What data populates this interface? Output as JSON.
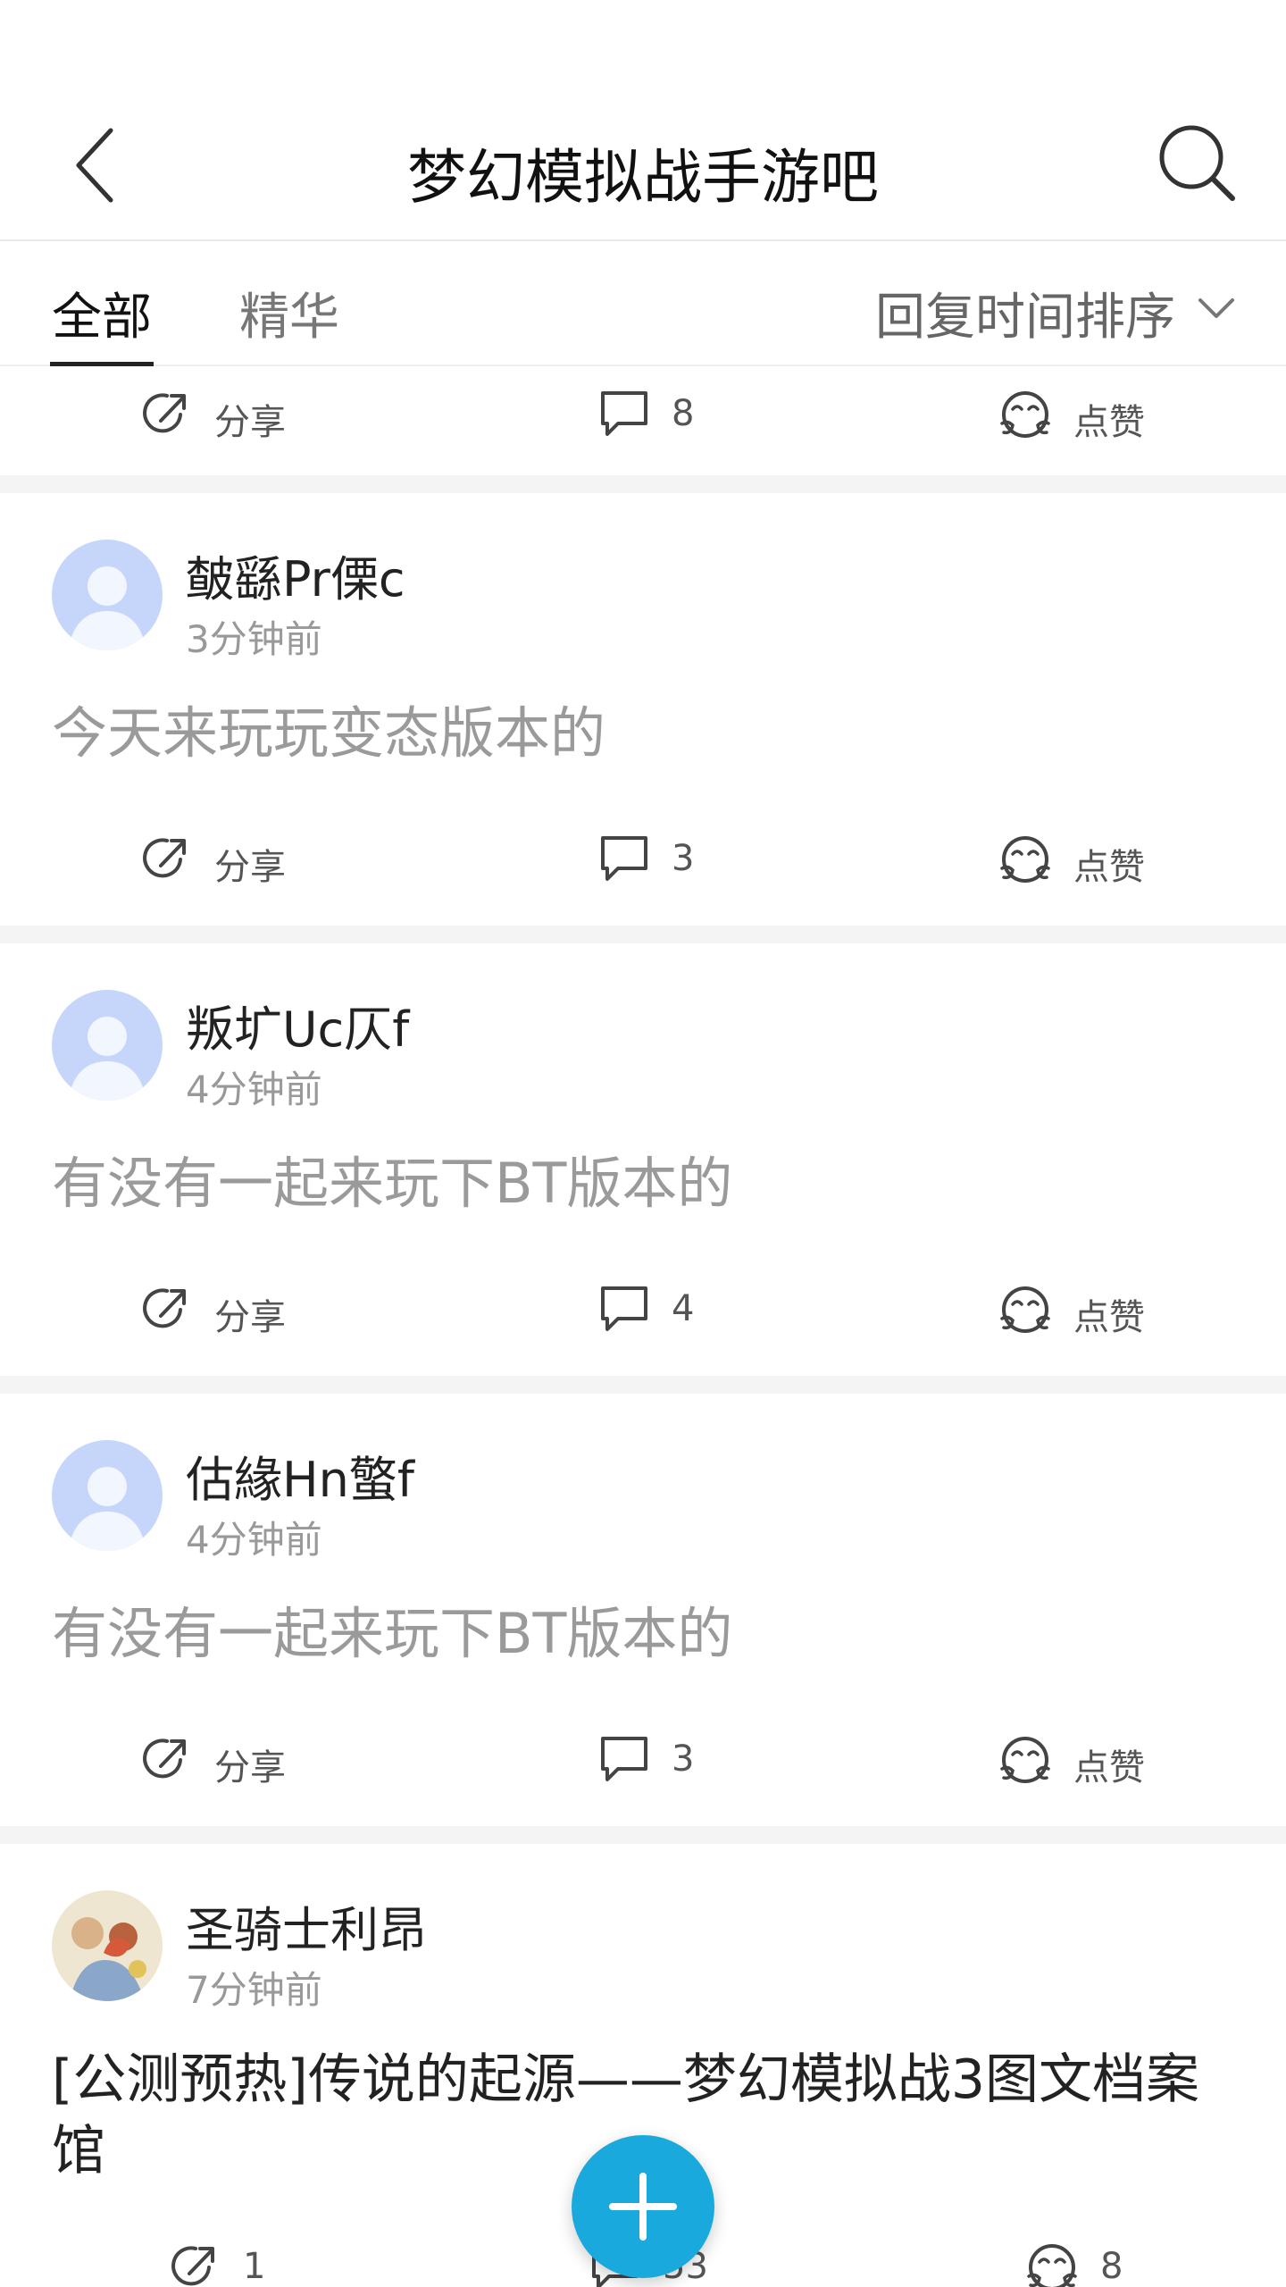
{
  "header": {
    "title": "梦幻模拟战手游吧",
    "back_icon": "chevron-left-icon",
    "search_icon": "search-icon"
  },
  "tabs": {
    "all_label": "全部",
    "elite_label": "精华",
    "sort_label": "回复时间排序",
    "sort_icon": "chevron-down-icon"
  },
  "partial_post": {
    "share_label": "分享",
    "comment_count": "8",
    "like_label": "点赞"
  },
  "posts": [
    {
      "username": "皶繇Pr傈c",
      "time": "3分钟前",
      "content": "今天来玩玩变态版本的",
      "share_label": "分享",
      "comment_count": "3",
      "like_label": "点赞"
    },
    {
      "username": "叛圹Uc仄f",
      "time": "4分钟前",
      "content": "有没有一起来玩下BT版本的",
      "share_label": "分享",
      "comment_count": "4",
      "like_label": "点赞"
    },
    {
      "username": "估緣Hn蟼f",
      "time": "4分钟前",
      "content": "有没有一起来玩下BT版本的",
      "share_label": "分享",
      "comment_count": "3",
      "like_label": "点赞"
    },
    {
      "username": "圣骑士利昂",
      "time": "7分钟前",
      "content": "[公测预热]传说的起源——梦幻模拟战3图文档案馆",
      "share_label": "1",
      "comment_count": "53",
      "like_label": "8"
    }
  ],
  "fab": {
    "icon": "plus-icon"
  },
  "colors": {
    "accent": "#1aa9dc",
    "divider": "#f4f4f4"
  }
}
